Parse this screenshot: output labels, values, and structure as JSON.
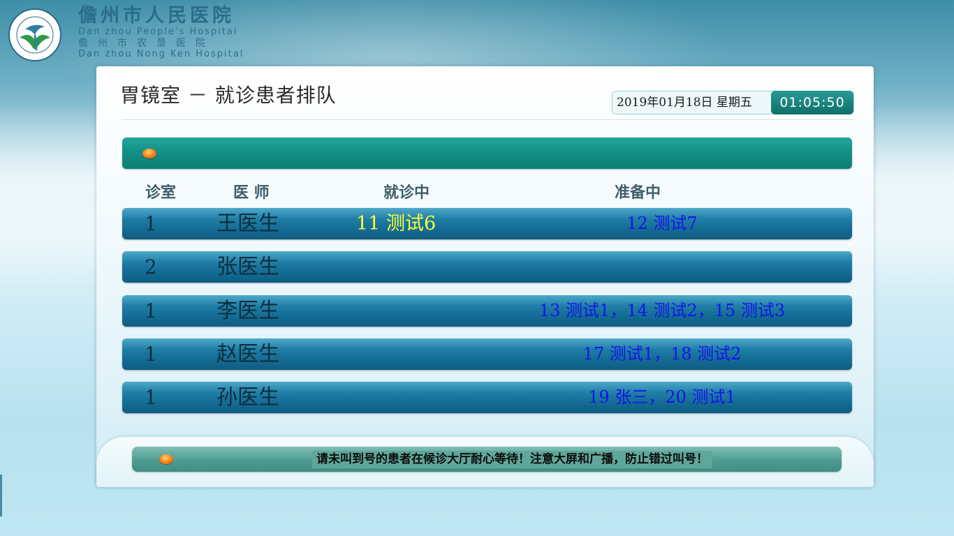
{
  "hospital": {
    "name_cn": "儋州市人民医院",
    "name_en": "Dan zhou People's Hospital",
    "name_cn_2": "儋州市农垦医院",
    "name_en_2": "Dan zhou Nong Ken Hospital"
  },
  "page": {
    "title": "胃镜室 － 就诊患者排队"
  },
  "clock": {
    "date": "2019年01月18日  星期五",
    "time": "01:05:50"
  },
  "columns": {
    "room": "诊室",
    "doctor": "医 师",
    "current": "就诊中",
    "waiting": "准备中"
  },
  "rows": [
    {
      "room": "1",
      "doctor": "王医生",
      "current": "11  测试6",
      "waiting": "12  测试7"
    },
    {
      "room": "2",
      "doctor": "张医生",
      "current": "",
      "waiting": ""
    },
    {
      "room": "1",
      "doctor": "李医生",
      "current": "",
      "waiting": "13  测试1，14  测试2，15  测试3"
    },
    {
      "room": "1",
      "doctor": "赵医生",
      "current": "",
      "waiting": "17  测试1，18  测试2"
    },
    {
      "room": "1",
      "doctor": "孙医生",
      "current": "",
      "waiting": "19  张三，20  测试1"
    }
  ],
  "footer": {
    "notice": "请未叫到号的患者在候诊大厅耐心等待！注意大屏和广播，防止错过叫号！"
  },
  "colors": {
    "current_text": "#ffff33",
    "waiting_text": "#1414ee",
    "header_bar": "#139086",
    "row_bar": "#1f7ea6"
  }
}
